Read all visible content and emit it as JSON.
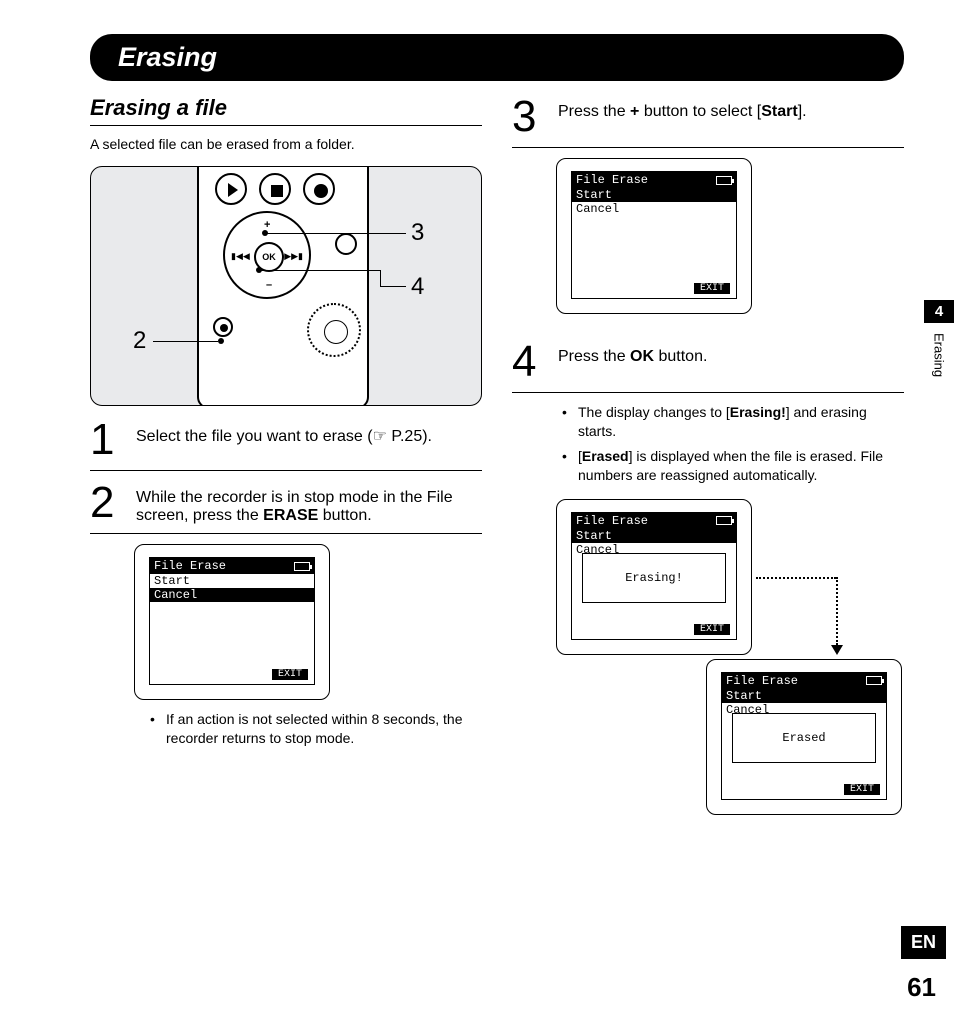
{
  "title": "Erasing",
  "section_heading": "Erasing a file",
  "intro": "A selected file can be erased from a folder.",
  "device": {
    "ok": "OK",
    "callouts": {
      "c2": "2",
      "c3": "3",
      "c4": "4"
    }
  },
  "steps": {
    "s1": {
      "num": "1",
      "text_a": "Select the file you want to erase (",
      "ref": "☞ P.25",
      "text_b": ")."
    },
    "s2": {
      "num": "2",
      "text_a": "While the recorder is in stop mode in the File screen, press the ",
      "bold": "ERASE",
      "text_b": " button."
    },
    "s2_note": "If an action is not selected within 8 seconds, the recorder returns to stop mode.",
    "s3": {
      "num": "3",
      "text_a": "Press the ",
      "bold": "+",
      "text_b": " button to select [",
      "bold2": "Start",
      "text_c": "]."
    },
    "s4": {
      "num": "4",
      "text_a": "Press the ",
      "bold": "OK",
      "text_b": " button."
    },
    "s4_b1a": "The display changes to [",
    "s4_b1b": "Erasing!",
    "s4_b1c": "] and erasing starts.",
    "s4_b2a": "[",
    "s4_b2b": "Erased",
    "s4_b2c": "] is displayed when the file is erased. File numbers are reassigned automatically."
  },
  "lcd": {
    "title": "File Erase",
    "start": "Start",
    "cancel": "Cancel",
    "exit": "EXIT",
    "erasing": "Erasing!",
    "erased": "Erased"
  },
  "sidebar": {
    "chapter": "4",
    "label": "Erasing"
  },
  "lang": "EN",
  "page": "61"
}
